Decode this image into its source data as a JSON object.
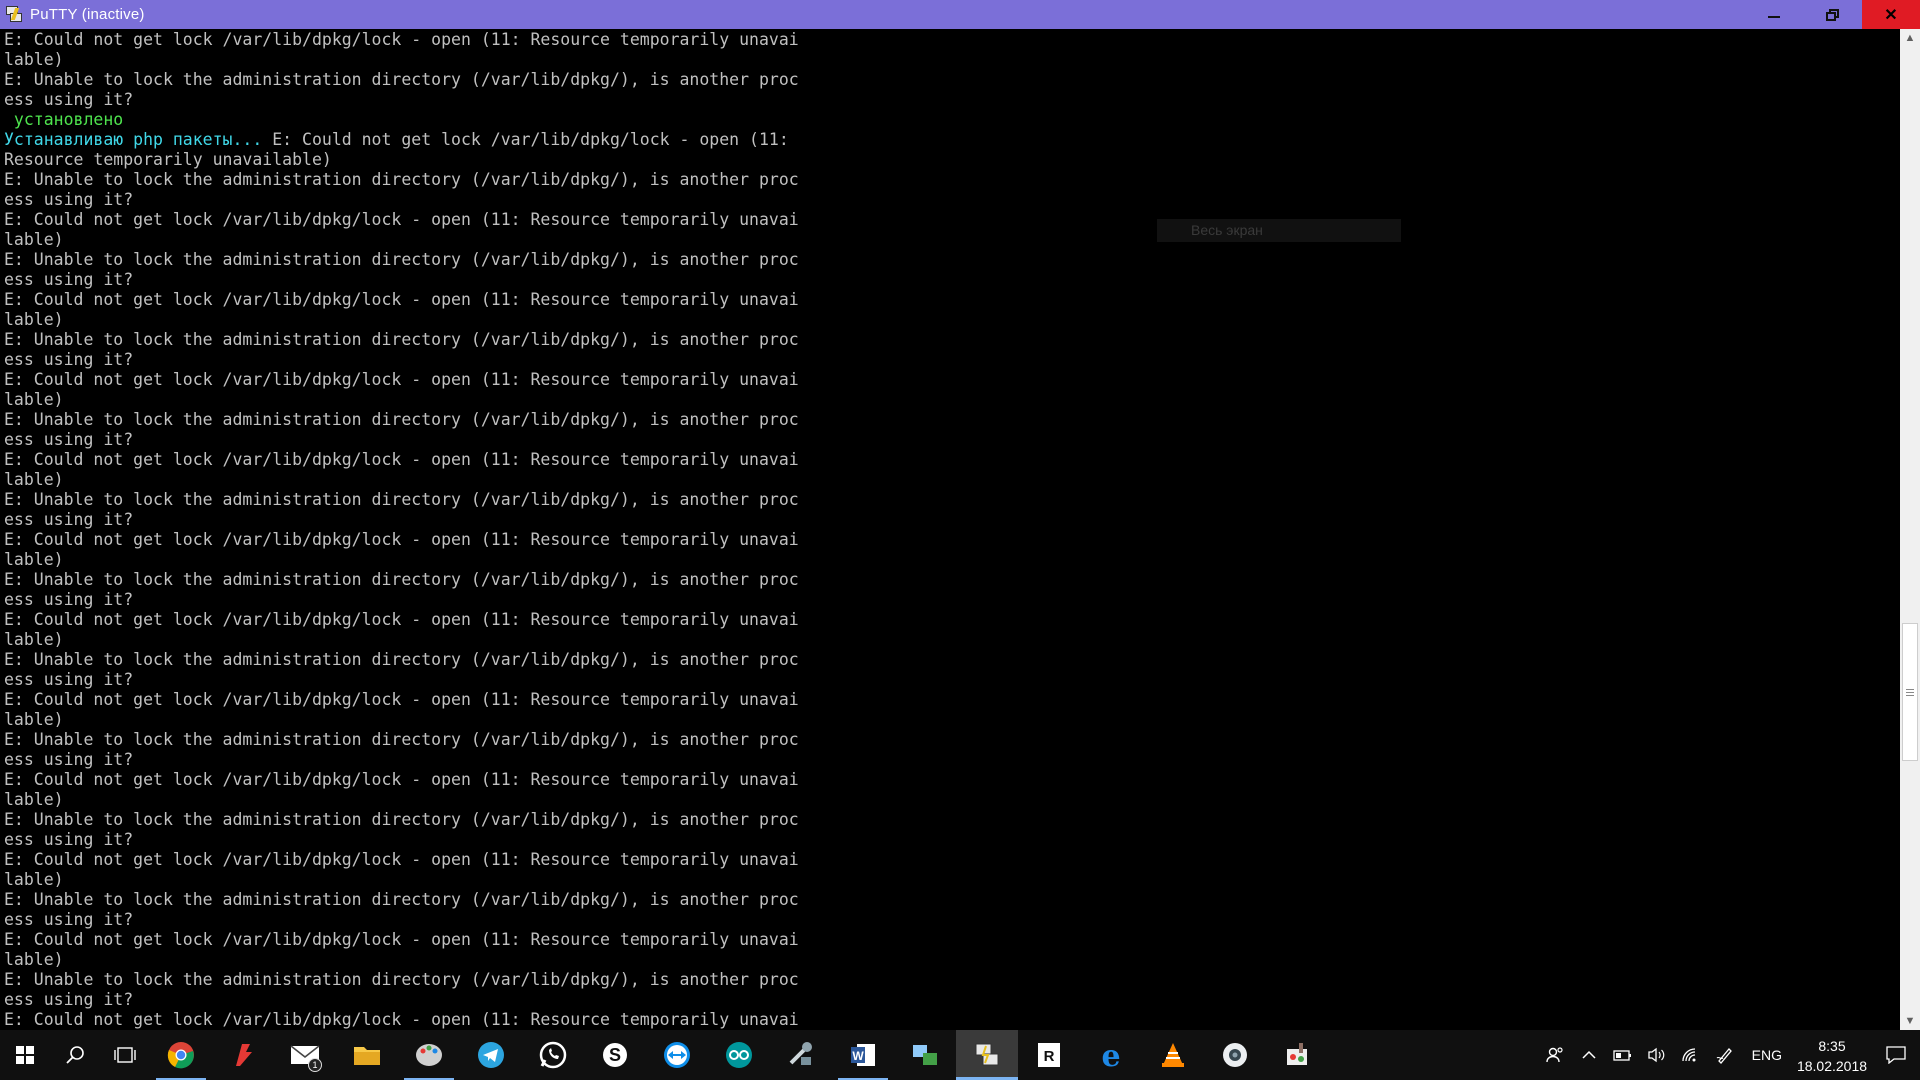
{
  "window": {
    "title": "PuTTY (inactive)"
  },
  "terminal": {
    "lines": [
      {
        "t": "E: Could not get lock /var/lib/dpkg/lock - open (11: Resource temporarily unavai",
        "c": ""
      },
      {
        "t": "lable)",
        "c": ""
      },
      {
        "t": "E: Unable to lock the administration directory (/var/lib/dpkg/), is another proc",
        "c": ""
      },
      {
        "t": "ess using it?",
        "c": ""
      },
      {
        "t": " установлено",
        "c": "green"
      },
      {
        "t": "Устанавливаю php пакеты... ",
        "c": "cyan",
        "rest": "E: Could not get lock /var/lib/dpkg/lock - open (11:"
      },
      {
        "t": "Resource temporarily unavailable)",
        "c": ""
      },
      {
        "t": "E: Unable to lock the administration directory (/var/lib/dpkg/), is another proc",
        "c": ""
      },
      {
        "t": "ess using it?",
        "c": ""
      },
      {
        "t": "E: Could not get lock /var/lib/dpkg/lock - open (11: Resource temporarily unavai",
        "c": ""
      },
      {
        "t": "lable)",
        "c": ""
      },
      {
        "t": "E: Unable to lock the administration directory (/var/lib/dpkg/), is another proc",
        "c": ""
      },
      {
        "t": "ess using it?",
        "c": ""
      },
      {
        "t": "E: Could not get lock /var/lib/dpkg/lock - open (11: Resource temporarily unavai",
        "c": ""
      },
      {
        "t": "lable)",
        "c": ""
      },
      {
        "t": "E: Unable to lock the administration directory (/var/lib/dpkg/), is another proc",
        "c": ""
      },
      {
        "t": "ess using it?",
        "c": ""
      },
      {
        "t": "E: Could not get lock /var/lib/dpkg/lock - open (11: Resource temporarily unavai",
        "c": ""
      },
      {
        "t": "lable)",
        "c": ""
      },
      {
        "t": "E: Unable to lock the administration directory (/var/lib/dpkg/), is another proc",
        "c": ""
      },
      {
        "t": "ess using it?",
        "c": ""
      },
      {
        "t": "E: Could not get lock /var/lib/dpkg/lock - open (11: Resource temporarily unavai",
        "c": ""
      },
      {
        "t": "lable)",
        "c": ""
      },
      {
        "t": "E: Unable to lock the administration directory (/var/lib/dpkg/), is another proc",
        "c": ""
      },
      {
        "t": "ess using it?",
        "c": ""
      },
      {
        "t": "E: Could not get lock /var/lib/dpkg/lock - open (11: Resource temporarily unavai",
        "c": ""
      },
      {
        "t": "lable)",
        "c": ""
      },
      {
        "t": "E: Unable to lock the administration directory (/var/lib/dpkg/), is another proc",
        "c": ""
      },
      {
        "t": "ess using it?",
        "c": ""
      },
      {
        "t": "E: Could not get lock /var/lib/dpkg/lock - open (11: Resource temporarily unavai",
        "c": ""
      },
      {
        "t": "lable)",
        "c": ""
      },
      {
        "t": "E: Unable to lock the administration directory (/var/lib/dpkg/), is another proc",
        "c": ""
      },
      {
        "t": "ess using it?",
        "c": ""
      },
      {
        "t": "E: Could not get lock /var/lib/dpkg/lock - open (11: Resource temporarily unavai",
        "c": ""
      },
      {
        "t": "lable)",
        "c": ""
      },
      {
        "t": "E: Unable to lock the administration directory (/var/lib/dpkg/), is another proc",
        "c": ""
      },
      {
        "t": "ess using it?",
        "c": ""
      },
      {
        "t": "E: Could not get lock /var/lib/dpkg/lock - open (11: Resource temporarily unavai",
        "c": ""
      },
      {
        "t": "lable)",
        "c": ""
      },
      {
        "t": "E: Unable to lock the administration directory (/var/lib/dpkg/), is another proc",
        "c": ""
      },
      {
        "t": "ess using it?",
        "c": ""
      },
      {
        "t": "E: Could not get lock /var/lib/dpkg/lock - open (11: Resource temporarily unavai",
        "c": ""
      },
      {
        "t": "lable)",
        "c": ""
      },
      {
        "t": "E: Unable to lock the administration directory (/var/lib/dpkg/), is another proc",
        "c": ""
      },
      {
        "t": "ess using it?",
        "c": ""
      },
      {
        "t": "E: Could not get lock /var/lib/dpkg/lock - open (11: Resource temporarily unavai",
        "c": ""
      },
      {
        "t": "lable)",
        "c": ""
      },
      {
        "t": "E: Unable to lock the administration directory (/var/lib/dpkg/), is another proc",
        "c": ""
      },
      {
        "t": "ess using it?",
        "c": ""
      },
      {
        "t": "E: Could not get lock /var/lib/dpkg/lock - open (11: Resource temporarily unavai",
        "c": ""
      }
    ],
    "overlay_text": "Весь экран"
  },
  "taskbar": {
    "apps": [
      {
        "name": "start-icon",
        "active": false
      },
      {
        "name": "search-icon",
        "active": false
      },
      {
        "name": "task-view-icon",
        "active": false
      },
      {
        "name": "chrome-icon",
        "active": false,
        "running": true
      },
      {
        "name": "foxit-icon",
        "active": false
      },
      {
        "name": "mail-icon",
        "active": false,
        "badge": "1"
      },
      {
        "name": "file-explorer-icon",
        "active": false
      },
      {
        "name": "paint-icon",
        "active": false,
        "running": true
      },
      {
        "name": "telegram-icon",
        "active": false
      },
      {
        "name": "whatsapp-icon",
        "active": false
      },
      {
        "name": "skype-icon",
        "active": false
      },
      {
        "name": "teamviewer-icon",
        "active": false
      },
      {
        "name": "arduino-icon",
        "active": false
      },
      {
        "name": "tools-icon",
        "active": false
      },
      {
        "name": "word-icon",
        "active": false,
        "running": true
      },
      {
        "name": "network-share-icon",
        "active": false
      },
      {
        "name": "putty-icon",
        "active": true
      },
      {
        "name": "reader-icon",
        "active": false
      },
      {
        "name": "edge-icon",
        "active": false
      },
      {
        "name": "vlc-icon",
        "active": false
      },
      {
        "name": "camera-icon",
        "active": false
      },
      {
        "name": "paint-net-icon",
        "active": false
      }
    ],
    "tray": {
      "language": "ENG",
      "time": "8:35",
      "date": "18.02.2018"
    }
  },
  "colors": {
    "titlebar": "#7b6fd8",
    "close_button": "#e01b24",
    "terminal_text": "#c0c0c0",
    "green": "#4ee44e",
    "cyan": "#40d8e8"
  }
}
